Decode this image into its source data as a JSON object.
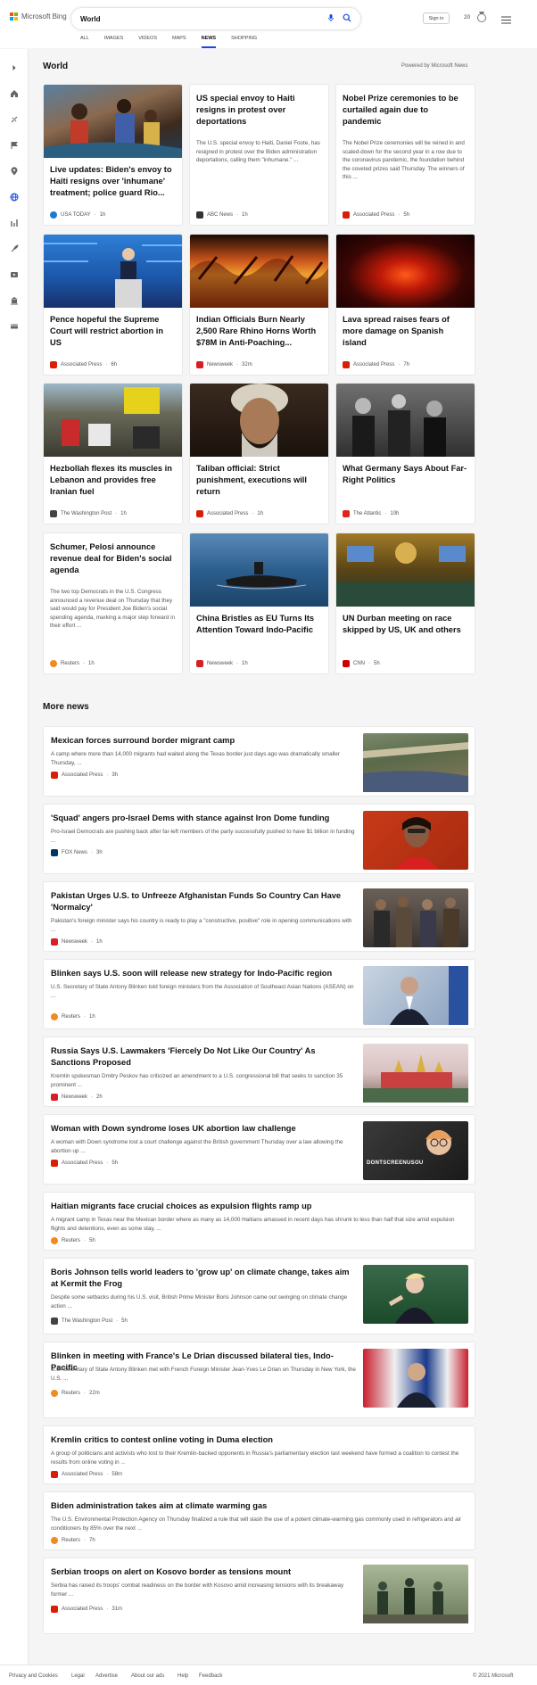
{
  "header": {
    "logo_text": "Microsoft Bing",
    "search_value": "World",
    "signin_label": "Sign in",
    "points": "20",
    "tabs": [
      {
        "label": "ALL",
        "active": false
      },
      {
        "label": "IMAGES",
        "active": false
      },
      {
        "label": "VIDEOS",
        "active": false
      },
      {
        "label": "MAPS",
        "active": false
      },
      {
        "label": "NEWS",
        "active": true
      },
      {
        "label": "SHOPPING",
        "active": false
      }
    ]
  },
  "sidebar": {
    "icons": [
      "chevron-right-icon",
      "home-icon",
      "sports-icon",
      "flag-icon",
      "location-pin-icon",
      "globe-icon",
      "money-icon",
      "rocket-icon",
      "video-icon",
      "building-icon",
      "card-icon"
    ]
  },
  "main": {
    "section_title": "World",
    "powered_by": "Powered by Microsoft News",
    "more_title": "More news"
  },
  "cards": [
    {
      "title": "Live updates: Biden's envoy to Haiti resigns over 'inhumane' treatment; police guard Rio...",
      "snippet": "",
      "source": "USA TODAY",
      "time": "1h",
      "src_color": "#1a7bd5",
      "src_letter": "U"
    },
    {
      "title": "US special envoy to Haiti resigns in protest over deportations",
      "snippet": "The U.S. special envoy to Haiti, Daniel Foote, has resigned in protest over the Biden administration deportations, calling them \"inhumane.\" ...",
      "source": "ABC News",
      "time": "1h",
      "src_color": "#333333",
      "src_letter": "A"
    },
    {
      "title": "Nobel Prize ceremonies to be curtailed again due to pandemic",
      "snippet": "The Nobel Prize ceremonies will be reined in and scaled-down for the second year in a row due to the coronavirus pandemic, the foundation behind the coveted prizes said Thursday. The winners of this ...",
      "source": "Associated Press",
      "time": "5h",
      "src_color": "#d81e05",
      "src_letter": "AP"
    },
    {
      "title": "Pence hopeful the Supreme Court will restrict abortion in US",
      "snippet": "",
      "source": "Associated Press",
      "time": "6h",
      "src_color": "#d81e05",
      "src_letter": "AP"
    },
    {
      "title": "Indian Officials Burn Nearly 2,500 Rare Rhino Horns Worth $78M in Anti-Poaching...",
      "snippet": "",
      "source": "Newsweek",
      "time": "32m",
      "src_color": "#d61f26",
      "src_letter": "N"
    },
    {
      "title": "Lava spread raises fears of more damage on Spanish island",
      "snippet": "",
      "source": "Associated Press",
      "time": "7h",
      "src_color": "#d81e05",
      "src_letter": "AP"
    },
    {
      "title": "Hezbollah flexes its muscles in Lebanon and provides free Iranian fuel",
      "snippet": "",
      "source": "The Washington Post",
      "time": "1h",
      "src_color": "#444444",
      "src_letter": "wp"
    },
    {
      "title": "Taliban official: Strict punishment, executions will return",
      "snippet": "",
      "source": "Associated Press",
      "time": "1h",
      "src_color": "#d81e05",
      "src_letter": "AP"
    },
    {
      "title": "What Germany Says About Far-Right Politics",
      "snippet": "",
      "source": "The Atlantic",
      "time": "10h",
      "src_color": "#e2231a",
      "src_letter": "A"
    },
    {
      "title": "Schumer, Pelosi announce revenue deal for Biden's social agenda",
      "snippet": "The two top Democrats in the U.S. Congress announced a revenue deal on Thursday that they said would pay for President Joe Biden's social spending agenda, marking a major step forward in their effort ...",
      "source": "Reuters",
      "time": "1h",
      "src_color": "#f08a24",
      "src_letter": "R"
    },
    {
      "title": "China Bristles as EU Turns Its Attention Toward Indo-Pacific",
      "snippet": "",
      "source": "Newsweek",
      "time": "1h",
      "src_color": "#d61f26",
      "src_letter": "N"
    },
    {
      "title": "UN Durban meeting on race skipped by US, UK and others",
      "snippet": "",
      "source": "CNN",
      "time": "5h",
      "src_color": "#cc0000",
      "src_letter": "CNN"
    }
  ],
  "more": [
    {
      "title": "Mexican forces surround border migrant camp",
      "snippet": "A camp where more than 14,000 migrants had waited along the Texas border just days ago was dramatically smaller Thursday, ...",
      "source": "Associated Press",
      "time": "3h",
      "src_color": "#d81e05",
      "src_letter": "AP",
      "thumb": true
    },
    {
      "title": "'Squad' angers pro-Israel Dems with stance against Iron Dome funding",
      "snippet": "Pro-Israel Democrats are pushing back after far-left members of the party successfully pushed to have $1 billion in funding ...",
      "source": "FOX News",
      "time": "3h",
      "src_color": "#003366",
      "src_letter": "F",
      "thumb": true
    },
    {
      "title": "Pakistan Urges U.S. to Unfreeze Afghanistan Funds So Country Can Have 'Normalcy'",
      "snippet": "Pakistan's foreign minister says his country is ready to play a \"constructive, positive\" role in opening communications with ...",
      "source": "Newsweek",
      "time": "1h",
      "src_color": "#d61f26",
      "src_letter": "N",
      "thumb": true
    },
    {
      "title": "Blinken says U.S. soon will release new strategy for Indo-Pacific region",
      "snippet": "U.S. Secretary of State Antony Blinken told foreign ministers from the Association of Southeast Asian Nations (ASEAN) on ...",
      "source": "Reuters",
      "time": "1h",
      "src_color": "#f08a24",
      "src_letter": "R",
      "thumb": true
    },
    {
      "title": "Russia Says U.S. Lawmakers 'Fiercely Do Not Like Our Country' As Sanctions Proposed",
      "snippet": "Kremlin spokesman Dmitry Peskov has criticized an amendment to a U.S. congressional bill that seeks to sanction 35 prominent ...",
      "source": "Newsweek",
      "time": "2h",
      "src_color": "#d61f26",
      "src_letter": "N",
      "thumb": true
    },
    {
      "title": "Woman with Down syndrome loses UK abortion law challenge",
      "snippet": "A woman with Down syndrome lost a court challenge against the British government Thursday over a law allowing the abortion up ...",
      "source": "Associated Press",
      "time": "5h",
      "src_color": "#d81e05",
      "src_letter": "AP",
      "thumb": true,
      "thumb_text": "DONTSCREENUSOU"
    },
    {
      "title": "Haitian migrants face crucial choices as expulsion flights ramp up",
      "snippet": "A migrant camp in Texas near the Mexican border where as many as 14,000 Haitians amassed in recent days has shrunk to less than half that size amid expulsion flights and detentions, even as some stay, ...",
      "source": "Reuters",
      "time": "5h",
      "src_color": "#f08a24",
      "src_letter": "R",
      "thumb": false
    },
    {
      "title": "Boris Johnson tells world leaders to 'grow up' on climate change, takes aim at Kermit the Frog",
      "snippet": "Despite some setbacks during his U.S. visit, British Prime Minister Boris Johnson came out swinging on climate change action ...",
      "source": "The Washington Post",
      "time": "5h",
      "src_color": "#444444",
      "src_letter": "wp",
      "thumb": true
    },
    {
      "title": "Blinken in meeting with France's Le Drian discussed bilateral ties, Indo-Pacific",
      "snippet": "U.S. Secretary of State Antony Blinken met with French Foreign Minister Jean-Yves Le Drian on Thursday in New York, the U.S. ...",
      "source": "Reuters",
      "time": "22m",
      "src_color": "#f08a24",
      "src_letter": "R",
      "thumb": true
    },
    {
      "title": "Kremlin critics to contest online voting in Duma election",
      "snippet": "A group of politicians and activists who lost to their Kremlin-backed opponents in Russia's parliamentary election last weekend have formed a coalition to contest the results from online voting in ...",
      "source": "Associated Press",
      "time": "58m",
      "src_color": "#d81e05",
      "src_letter": "AP",
      "thumb": false
    },
    {
      "title": "Biden administration takes aim at climate warming gas",
      "snippet": "The U.S. Environmental Protection Agency on Thursday finalized a rule that will slash the use of a potent climate-warming gas commonly used in refrigerators and air conditioners by 85% over the next ...",
      "source": "Reuters",
      "time": "7h",
      "src_color": "#f08a24",
      "src_letter": "R",
      "thumb": false
    },
    {
      "title": "Serbian troops on alert on Kosovo border as tensions mount",
      "snippet": "Serbia has raised its troops' combat readiness on the border with Kosovo amid increasing tensions with its breakaway former ...",
      "source": "Associated Press",
      "time": "31m",
      "src_color": "#d81e05",
      "src_letter": "AP",
      "thumb": true
    }
  ],
  "footer": {
    "links": [
      "Privacy and Cookies",
      "Legal",
      "Advertise",
      "About our ads",
      "Help",
      "Feedback"
    ],
    "copyright": "© 2021 Microsoft"
  }
}
